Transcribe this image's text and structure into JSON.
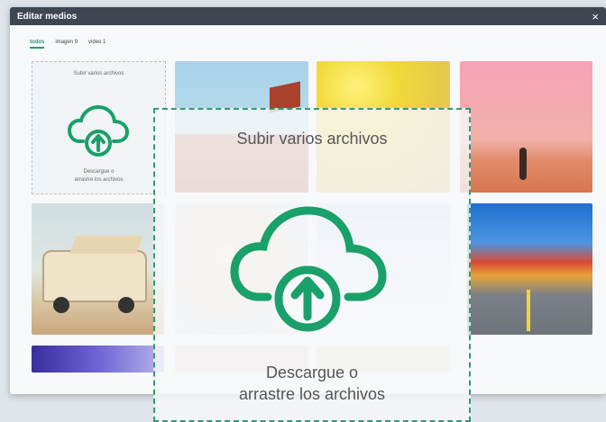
{
  "window": {
    "title": "Editar medios",
    "close_glyph": "×"
  },
  "tabs": [
    {
      "label": "todos",
      "active": true
    },
    {
      "label": "imagen 9",
      "active": false
    },
    {
      "label": "video 1",
      "active": false
    }
  ],
  "upload_tile": {
    "title": "Subir varios archivos",
    "hint_line1": "Descargue o",
    "hint_line2": "arrastre los archivos"
  },
  "drop_overlay": {
    "title": "Subir varios archivos",
    "hint_line1": "Descargue o",
    "hint_line2": "arrastre los archivos"
  },
  "colors": {
    "accent": "#1aa06a",
    "titlebar": "#3d4651",
    "overlay_border": "#2f9a72"
  }
}
